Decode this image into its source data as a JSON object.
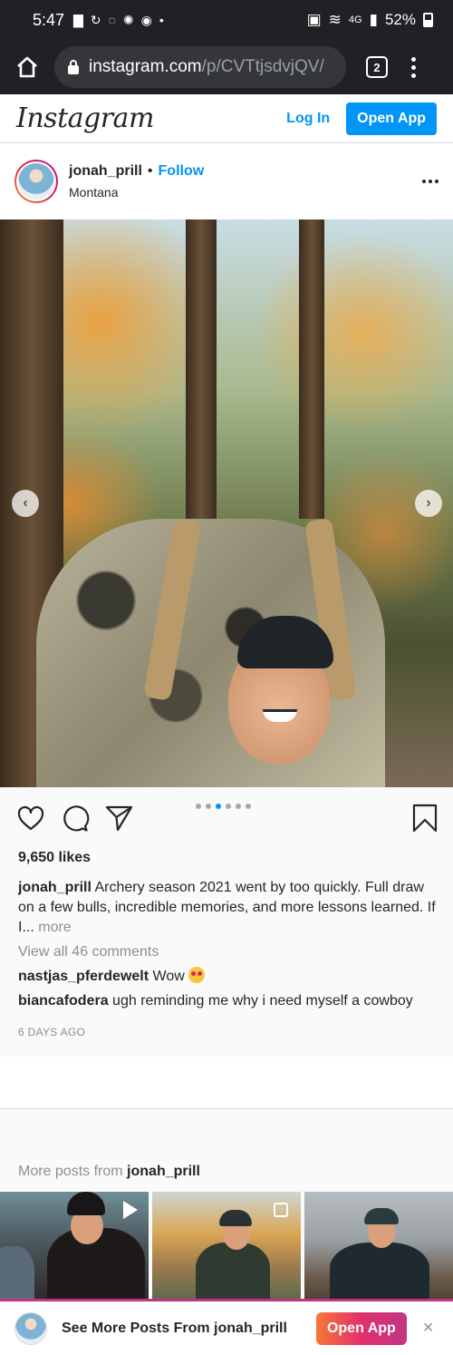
{
  "status_bar": {
    "time": "5:47",
    "network": "4G",
    "battery": "52%"
  },
  "browser": {
    "url_domain": "instagram.com",
    "url_path": "/p/CVTtjsdvjQV/",
    "tab_count": "2"
  },
  "ig_header": {
    "logo": "Instagram",
    "login_label": "Log In",
    "open_app_label": "Open App"
  },
  "post": {
    "username": "jonah_prill",
    "follow_label": "Follow",
    "location": "Montana",
    "carousel": {
      "count": 6,
      "active_index": 2
    },
    "likes": "9,650 likes",
    "caption_user": "jonah_prill",
    "caption_text": "Archery season 2021 went by too quickly. Full draw on a few bulls, incredible memories, and more lessons learned. If I...",
    "more_label": "more",
    "view_all_comments": "View all 46 comments",
    "comments": [
      {
        "user": "nastjas_pferdewelt",
        "text": "Wow"
      },
      {
        "user": "biancafodera",
        "text": "ugh reminding me why i need myself a cowboy"
      }
    ],
    "time_ago": "6 DAYS AGO"
  },
  "more_posts": {
    "prefix": "More posts from",
    "username": "jonah_prill"
  },
  "bottom_banner": {
    "text": "See More Posts From jonah_prill",
    "open_app_label": "Open App",
    "close_label": "×"
  },
  "colors": {
    "accent_blue": "#0095f6",
    "text_dark": "#262626",
    "text_muted": "#8e8e8e",
    "browser_dark": "#202124"
  }
}
